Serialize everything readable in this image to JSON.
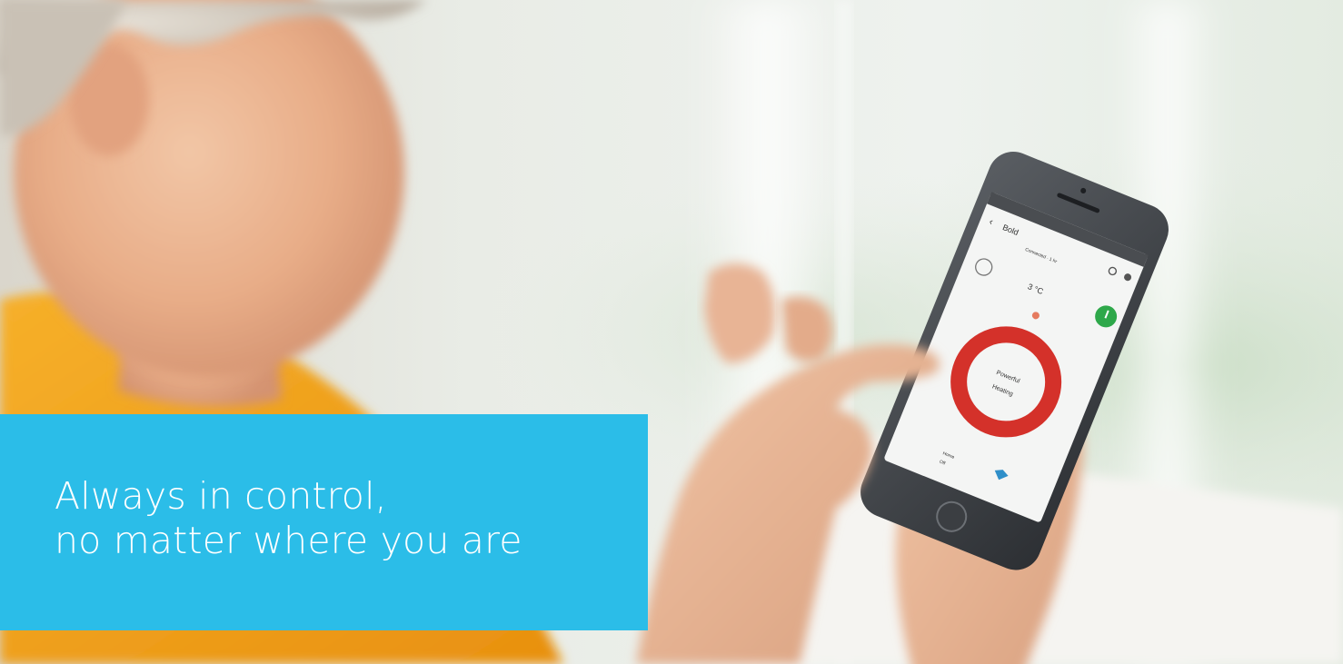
{
  "caption": {
    "line1": "Always in control,",
    "line2": "no matter where you are"
  },
  "phone_app": {
    "back_label": "‹",
    "header_title": "Bold",
    "header_subtitle": "Connected · 1 hr",
    "temperature": "3 °C",
    "mode_line1": "Powerful",
    "mode_line2": "Heating",
    "footer_item1": "Home",
    "footer_item2": "Off",
    "icons": [
      "back-arrow-icon",
      "refresh-icon",
      "settings-icon",
      "home-mode-icon",
      "power-icon",
      "fan-icon",
      "leaf-icon"
    ]
  },
  "colors": {
    "caption_background": "#2bbde8",
    "caption_text": "#ffffff",
    "power_button": "#2ea84a",
    "mode_ring": "#d4312a",
    "sweater": "#f2a41c"
  }
}
